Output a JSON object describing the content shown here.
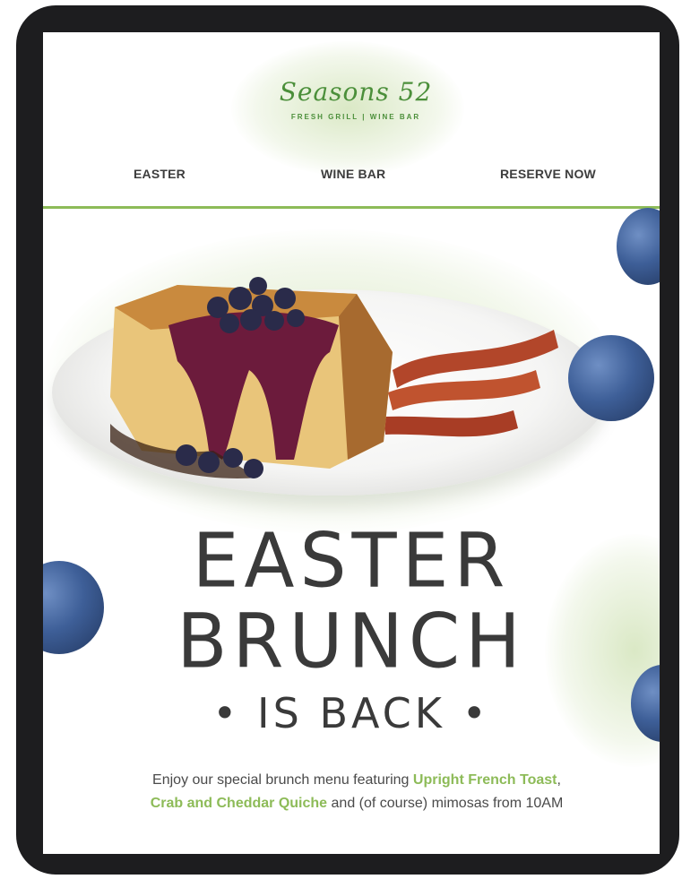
{
  "brand": {
    "name": "Seasons 52",
    "tagline": "FRESH GRILL | WINE BAR",
    "color": "#4b8f3a"
  },
  "nav": {
    "items": [
      {
        "label": "EASTER"
      },
      {
        "label": "WINE BAR"
      },
      {
        "label": "RESERVE NOW"
      }
    ],
    "divider_color": "#8dbb58"
  },
  "hero": {
    "image": "easter-french-toast-with-blueberries-and-bacon"
  },
  "headline": {
    "line1": "EASTER",
    "line2": "BRUNCH",
    "line3": "• IS BACK •"
  },
  "body": {
    "prefix": "Enjoy our special brunch menu featuring ",
    "highlight1": "Upright French Toast",
    "sep": ",",
    "highlight2": "Crab and Cheddar Quiche",
    "suffix": " and (of course) mimosas from 10AM",
    "accent_color": "#8dbb58"
  }
}
